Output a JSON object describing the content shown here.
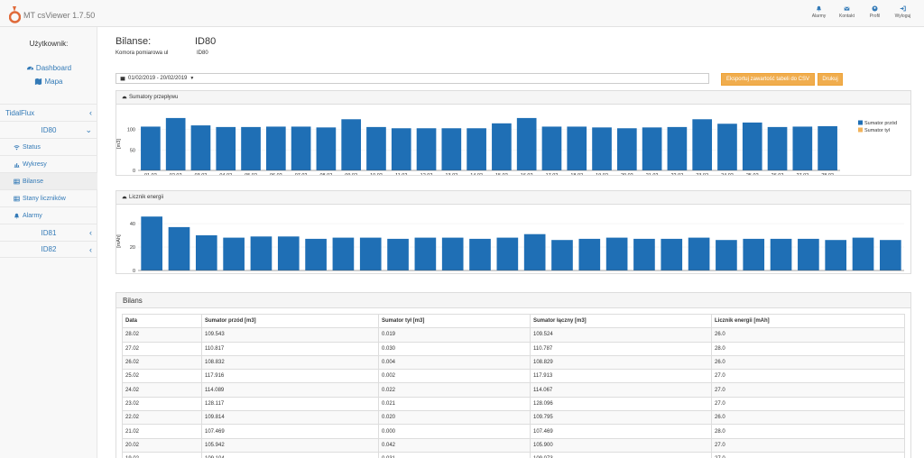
{
  "app": {
    "title": "MT csViewer 1.7.50"
  },
  "topnav": [
    {
      "label": "Alarmy",
      "icon": "bell-icon"
    },
    {
      "label": "Kontakt",
      "icon": "envelope-icon"
    },
    {
      "label": "Profil",
      "icon": "user-icon"
    },
    {
      "label": "Wyloguj",
      "icon": "logout-icon"
    }
  ],
  "sidebar": {
    "user_label": "Użytkownik:",
    "dashboard": "Dashboard",
    "map": "Mapa",
    "group": "TidalFlux",
    "device": "ID80",
    "items": [
      {
        "label": "Status",
        "icon": "wifi-icon"
      },
      {
        "label": "Wykresy",
        "icon": "bar-chart-icon"
      },
      {
        "label": "Bilanse",
        "icon": "table-icon"
      },
      {
        "label": "Stany liczników",
        "icon": "table-icon"
      },
      {
        "label": "Alarmy",
        "icon": "bell-icon"
      }
    ],
    "other_devices": [
      "ID81",
      "ID82"
    ]
  },
  "header": {
    "title": "Bilanse:",
    "id": "ID80",
    "sub_label": "Komora pomiarowa ul",
    "sub_id": "ID80"
  },
  "toolbar": {
    "date_range": "01/02/2019 - 20/02/2019",
    "export_label": "Eksportuj zawartość tabeli do CSV",
    "print_label": "Drukuj"
  },
  "chart_data": [
    {
      "type": "bar",
      "title": "Sumatory przepływu",
      "ylabel": "[m3]",
      "ylim": [
        0,
        130
      ],
      "yticks": [
        0,
        50,
        100
      ],
      "legend": [
        "Sumator przód",
        "Sumator tył"
      ],
      "legend_position": "right",
      "colors": [
        "#1f6fb5",
        "#f2b35a"
      ],
      "categories": [
        "01.02",
        "02.02",
        "03.02",
        "04.02",
        "05.02",
        "06.02",
        "07.02",
        "08.02",
        "09.02",
        "10.02",
        "11.02",
        "12.02",
        "13.02",
        "14.02",
        "15.02",
        "16.02",
        "17.02",
        "18.02",
        "19.02",
        "20.02",
        "21.02",
        "22.02",
        "23.02",
        "24.02",
        "25.02",
        "26.02",
        "27.02",
        "28.02"
      ],
      "series": [
        {
          "name": "Sumator przód",
          "values": [
            107,
            128,
            110,
            106,
            106,
            107,
            107,
            105,
            125,
            106,
            103,
            103,
            103,
            103,
            115,
            128,
            107,
            107,
            105,
            103,
            105,
            106,
            125,
            114,
            117,
            106,
            107,
            108
          ]
        },
        {
          "name": "Sumator tył",
          "values": [
            0.02,
            0.02,
            0.02,
            0.02,
            0.02,
            0.02,
            0.02,
            0.02,
            0.02,
            0.02,
            0.02,
            0.02,
            0.02,
            0.02,
            0.02,
            0.02,
            0.02,
            0.02,
            0.02,
            0.02,
            0.02,
            0.02,
            0.02,
            0.02,
            0.02,
            0.01,
            0.03,
            0.02
          ]
        }
      ]
    },
    {
      "type": "bar",
      "title": "Licznik energii",
      "ylabel": "[mAh]",
      "ylim": [
        0,
        50
      ],
      "yticks": [
        0,
        20,
        40
      ],
      "colors": [
        "#1f6fb5"
      ],
      "categories": [
        "01.02",
        "02.02",
        "03.02",
        "04.02",
        "05.02",
        "06.02",
        "07.02",
        "08.02",
        "09.02",
        "10.02",
        "11.02",
        "12.02",
        "13.02",
        "14.02",
        "15.02",
        "16.02",
        "17.02",
        "18.02",
        "19.02",
        "20.02",
        "21.02",
        "22.02",
        "23.02",
        "24.02",
        "25.02",
        "26.02",
        "27.02",
        "28.02"
      ],
      "series": [
        {
          "values": [
            46,
            37,
            30,
            28,
            29,
            29,
            27,
            28,
            28,
            27,
            28,
            28,
            27,
            28,
            31,
            26,
            27,
            28,
            27,
            27,
            28,
            26,
            27,
            27,
            27,
            26,
            28,
            26
          ]
        }
      ]
    }
  ],
  "table": {
    "title": "Bilans",
    "columns": [
      "Data",
      "Sumator przód [m3]",
      "Sumator tył [m3]",
      "Sumator łączny [m3]",
      "Licznik energii [mAh]"
    ],
    "rows": [
      [
        "28.02",
        "109.543",
        "0.019",
        "109.524",
        "26.0"
      ],
      [
        "27.02",
        "110.817",
        "0.030",
        "110.787",
        "28.0"
      ],
      [
        "26.02",
        "108.832",
        "0.004",
        "108.829",
        "26.0"
      ],
      [
        "25.02",
        "117.916",
        "0.002",
        "117.913",
        "27.0"
      ],
      [
        "24.02",
        "114.089",
        "0.022",
        "114.067",
        "27.0"
      ],
      [
        "23.02",
        "128.117",
        "0.021",
        "128.096",
        "27.0"
      ],
      [
        "22.02",
        "109.814",
        "0.020",
        "109.795",
        "26.0"
      ],
      [
        "21.02",
        "107.469",
        "0.000",
        "107.469",
        "28.0"
      ],
      [
        "20.02",
        "105.942",
        "0.042",
        "105.900",
        "27.0"
      ],
      [
        "19.02",
        "109.104",
        "0.031",
        "109.073",
        "27.0"
      ]
    ]
  }
}
